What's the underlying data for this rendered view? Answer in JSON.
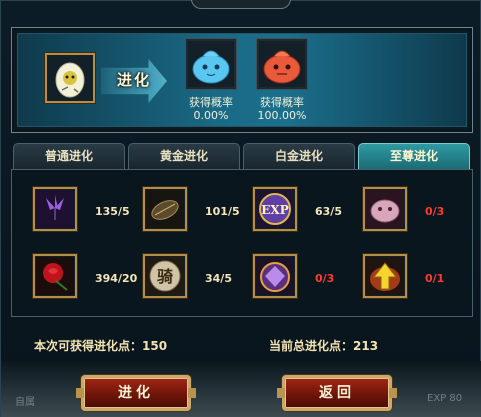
{
  "evolve": {
    "label": "进化",
    "targets": [
      {
        "caption": "获得概率",
        "percent": "0.00%"
      },
      {
        "caption": "获得概率",
        "percent": "100.00%"
      }
    ]
  },
  "tabs": [
    {
      "label": "普通进化",
      "active": false
    },
    {
      "label": "黄金进化",
      "active": false
    },
    {
      "label": "白金进化",
      "active": false
    },
    {
      "label": "至尊进化",
      "active": true
    }
  ],
  "materials": [
    {
      "icon": "purple-flower-icon",
      "count": "135/5",
      "insufficient": false
    },
    {
      "icon": "dark-seed-icon",
      "count": "101/5",
      "insufficient": false
    },
    {
      "icon": "exp-orb-icon",
      "badge": "EXP",
      "count": "63/5",
      "insufficient": false
    },
    {
      "icon": "pink-beast-icon",
      "count": "0/3",
      "insufficient": true
    },
    {
      "icon": "red-rose-icon",
      "count": "394/20",
      "insufficient": false
    },
    {
      "icon": "ride-token-icon",
      "badge": "骑",
      "count": "34/5",
      "insufficient": false
    },
    {
      "icon": "purple-gem-icon",
      "count": "0/3",
      "insufficient": true
    },
    {
      "icon": "upgrade-arrow-icon",
      "count": "0/1",
      "insufficient": true
    }
  ],
  "points": {
    "obtainable_label": "本次可获得进化点：",
    "obtainable_value": "150",
    "total_label": "当前总进化点：",
    "total_value": "213"
  },
  "buttons": {
    "evolve": "进化",
    "back": "返回"
  },
  "background_ghost_text": [
    "自属",
    "EXP 80"
  ]
}
